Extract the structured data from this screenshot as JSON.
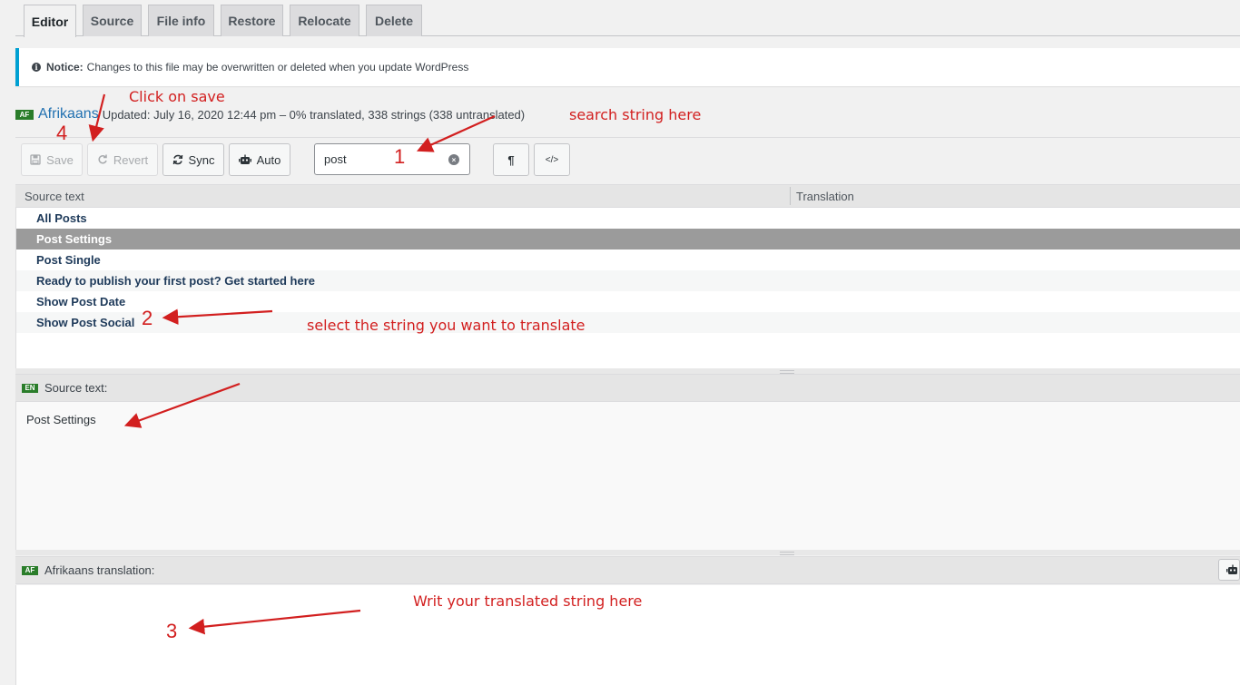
{
  "tabs": [
    {
      "label": "Editor",
      "active": true
    },
    {
      "label": "Source"
    },
    {
      "label": "File info"
    },
    {
      "label": "Restore"
    },
    {
      "label": "Relocate"
    },
    {
      "label": "Delete"
    }
  ],
  "notice": {
    "label": "Notice:",
    "text": "Changes to this file may be overwritten or deleted when you update WordPress"
  },
  "locale": {
    "flag": "AF",
    "name": "Afrikaans",
    "status": "Updated: July 16, 2020 12:44 pm – 0% translated, 338 strings (338 untranslated)"
  },
  "toolbar": {
    "save": "Save",
    "revert": "Revert",
    "sync": "Sync",
    "auto": "Auto",
    "search_value": "post",
    "pilcrow": "¶",
    "code": "</>"
  },
  "grid": {
    "source_header": "Source text",
    "translation_header": "Translation",
    "rows": [
      "All Posts",
      "Post Settings",
      "Post Single",
      "Ready to publish your first post? Get started here",
      "Show Post Date",
      "Show Post Social"
    ],
    "selected_index": 1
  },
  "source_pane": {
    "flag": "EN",
    "label": "Source text:",
    "text": "Post Settings"
  },
  "translation_pane": {
    "flag": "AF",
    "label": "Afrikaans translation:",
    "text": ""
  },
  "annotations": {
    "click_save": "Click on save",
    "search_here": "search string here",
    "select_string": "select the string you want to translate",
    "write_here": "Writ your translated string here",
    "n1": "1",
    "n2": "2",
    "n3": "3",
    "n4": "4"
  },
  "colors": {
    "accent": "#00a0d2",
    "annotation": "#d21f1f",
    "selected_row": "#9b9b9b",
    "locale_flag": "#2a7d2a"
  }
}
